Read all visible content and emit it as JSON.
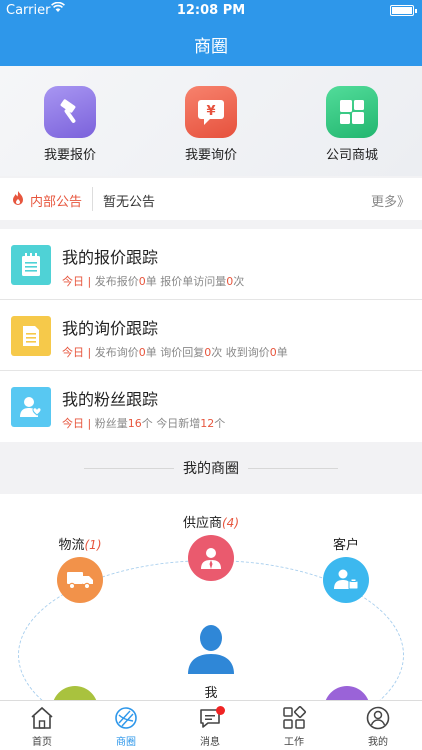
{
  "status": {
    "carrier": "Carrier",
    "time": "12:08 PM"
  },
  "nav": {
    "title": "商圈"
  },
  "quick": [
    {
      "label": "我要报价",
      "icon": "hammer-icon",
      "color": "#8a74e4"
    },
    {
      "label": "我要询价",
      "icon": "yuan-chat-icon",
      "color": "#ee6a54"
    },
    {
      "label": "公司商城",
      "icon": "grid-store-icon",
      "color": "#2fc27c"
    }
  ],
  "notice": {
    "tag": "内部公告",
    "message": "暂无公告",
    "more": "更多》"
  },
  "tracks": [
    {
      "title": "我的报价跟踪",
      "icon": "notepad-icon",
      "color": "#4fd2d6",
      "today": "今日",
      "bar": "|",
      "p1": "发布报价",
      "v1": "0",
      "u1": "单",
      "p2": "报价单访问量",
      "v2": "0",
      "u2": "次",
      "p3": "",
      "v3": "",
      "u3": ""
    },
    {
      "title": "我的询价跟踪",
      "icon": "document-icon",
      "color": "#f6c94a",
      "today": "今日",
      "bar": "|",
      "p1": "发布询价",
      "v1": "0",
      "u1": "单",
      "p2": "询价回复",
      "v2": "0",
      "u2": "次",
      "p3": "收到询价",
      "v3": "0",
      "u3": "单"
    },
    {
      "title": "我的粉丝跟踪",
      "icon": "fans-icon",
      "color": "#58c8f2",
      "today": "今日",
      "bar": "|",
      "p1": "粉丝量",
      "v1": "16",
      "u1": "个",
      "p2": "今日新增",
      "v2": "12",
      "u2": "个",
      "p3": "",
      "v3": "",
      "u3": ""
    }
  ],
  "circle": {
    "title": "我的商圈",
    "logistics": {
      "label": "物流",
      "count": "(1)"
    },
    "supplier": {
      "label": "供应商",
      "count": "(4)"
    },
    "customer": {
      "label": "客户",
      "count": ""
    },
    "me": {
      "label": "我"
    }
  },
  "tabs": [
    {
      "label": "首页",
      "icon": "home-icon"
    },
    {
      "label": "商圈",
      "icon": "circle-network-icon"
    },
    {
      "label": "消息",
      "icon": "message-icon"
    },
    {
      "label": "工作",
      "icon": "work-grid-icon"
    },
    {
      "label": "我的",
      "icon": "profile-icon"
    }
  ],
  "colors": {
    "primary": "#2e97ea",
    "alert": "#e7563e"
  }
}
